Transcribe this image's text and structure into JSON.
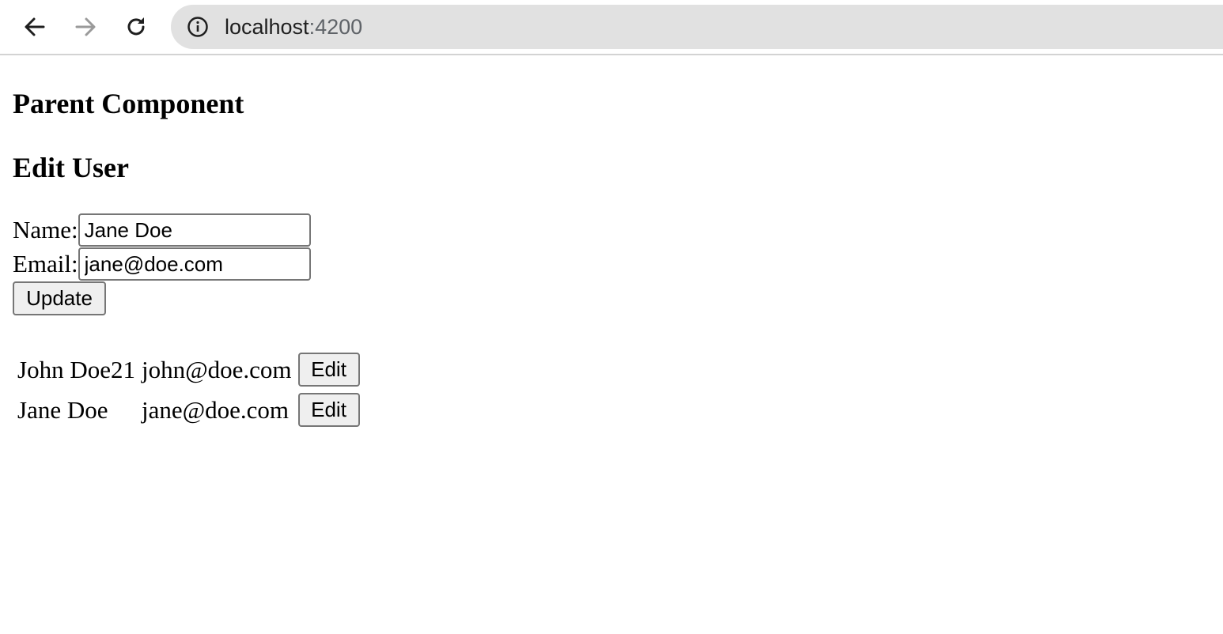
{
  "browser": {
    "url_host": "localhost",
    "url_port": ":4200",
    "icons": {
      "back": "arrow-left-icon",
      "forward": "arrow-right-icon",
      "reload": "reload-icon",
      "info": "info-icon"
    }
  },
  "page": {
    "parent_title": "Parent Component",
    "edit_title": "Edit User",
    "form": {
      "name_label": "Name:",
      "name_value": "Jane Doe",
      "email_label": "Email:",
      "email_value": "jane@doe.com",
      "update_label": "Update"
    },
    "users": [
      {
        "name": "John Doe21",
        "email": "john@doe.com",
        "edit_label": "Edit"
      },
      {
        "name": "Jane Doe",
        "email": "jane@doe.com",
        "edit_label": "Edit"
      }
    ]
  },
  "colors": {
    "address_bar_bg": "#e1e1e1",
    "button_bg": "#efefef",
    "border": "#767676"
  }
}
